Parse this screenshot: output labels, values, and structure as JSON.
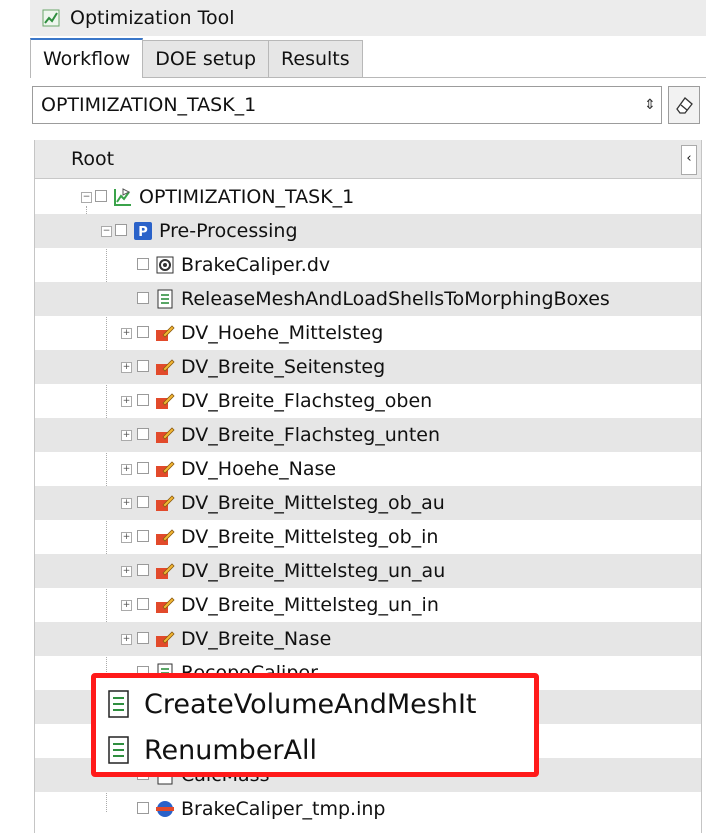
{
  "window": {
    "title": "Optimization Tool"
  },
  "tabs": [
    {
      "label": "Workflow",
      "active": true
    },
    {
      "label": "DOE setup",
      "active": false
    },
    {
      "label": "Results",
      "active": false
    }
  ],
  "task_select": {
    "value": "OPTIMIZATION_TASK_1"
  },
  "tree": {
    "header": "Root",
    "rows": [
      {
        "label": "OPTIMIZATION_TASK_1",
        "icon": "task-icon"
      },
      {
        "label": "Pre-Processing",
        "icon": "preprocessing-icon"
      },
      {
        "label": "BrakeCaliper.dv",
        "icon": "dv-file-icon"
      },
      {
        "label": "ReleaseMeshAndLoadShellsToMorphingBoxes",
        "icon": "script-icon"
      },
      {
        "label": "DV_Hoehe_Mittelsteg",
        "icon": "design-variable-icon"
      },
      {
        "label": "DV_Breite_Seitensteg",
        "icon": "design-variable-icon"
      },
      {
        "label": "DV_Breite_Flachsteg_oben",
        "icon": "design-variable-icon"
      },
      {
        "label": "DV_Breite_Flachsteg_unten",
        "icon": "design-variable-icon"
      },
      {
        "label": "DV_Hoehe_Nase",
        "icon": "design-variable-icon"
      },
      {
        "label": "DV_Breite_Mittelsteg_ob_au",
        "icon": "design-variable-icon"
      },
      {
        "label": "DV_Breite_Mittelsteg_ob_in",
        "icon": "design-variable-icon"
      },
      {
        "label": "DV_Breite_Mittelsteg_un_au",
        "icon": "design-variable-icon"
      },
      {
        "label": "DV_Breite_Mittelsteg_un_in",
        "icon": "design-variable-icon"
      },
      {
        "label": "DV_Breite_Nase",
        "icon": "design-variable-icon"
      },
      {
        "label": "RecopeCaliper",
        "icon": "script-icon"
      },
      {
        "label": "CalcMass",
        "icon": "script-icon"
      },
      {
        "label": "BrakeCaliper_tmp.inp",
        "icon": "solver-input-icon"
      }
    ]
  },
  "callout": {
    "items": [
      {
        "label": "CreateVolumeAndMeshIt",
        "icon": "script-icon"
      },
      {
        "label": "RenumberAll",
        "icon": "script-icon"
      }
    ],
    "border_color": "#ff1a1a"
  },
  "colors": {
    "dv_icon": "#e24a2b",
    "task_icon": "#3aa34a",
    "preproc_icon": "#2a62c9"
  }
}
